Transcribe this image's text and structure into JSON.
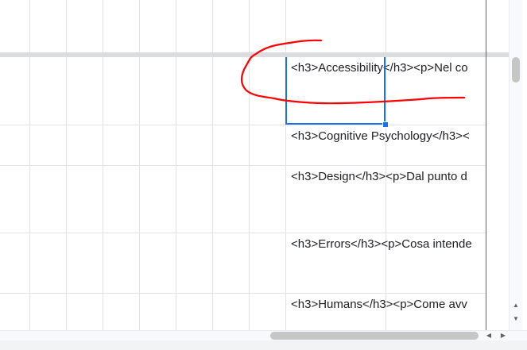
{
  "sheet": {
    "cells": [
      {
        "text": "<h3>Accessibility</h3><p>Nel co"
      },
      {
        "text": "<h3>Cognitive Psychology</h3><"
      },
      {
        "text": "<h3>Design</h3><p>Dal punto d"
      },
      {
        "text": "<h3>Errors</h3><p>Cosa intende"
      },
      {
        "text": "<h3>Humans</h3><p>Come avv"
      }
    ]
  },
  "scrollbars": {
    "up_arrow": "▲",
    "down_arrow": "▼",
    "left_arrow": "◀",
    "right_arrow": "▶"
  },
  "colors": {
    "selection": "#1a73e8",
    "annotation": "#ff0000",
    "frozen_border": "#1e8e3e",
    "gridline": "#e2e3e3"
  }
}
